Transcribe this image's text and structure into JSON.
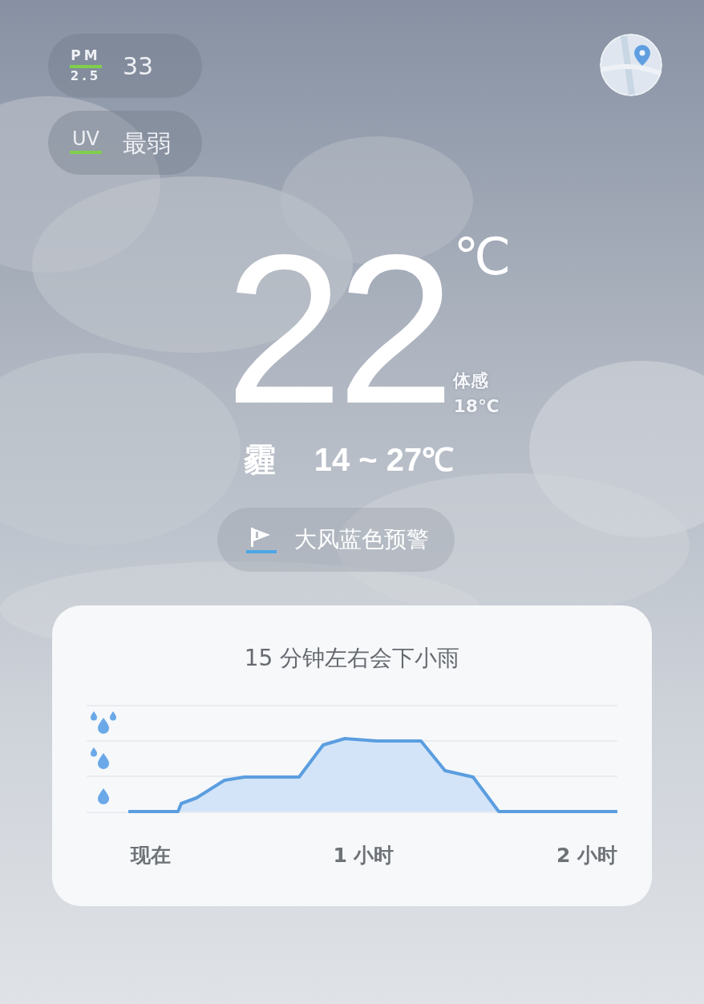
{
  "badges": [
    {
      "kind": "pm",
      "label": "PM",
      "sublabel": "2.5",
      "value": "33"
    },
    {
      "kind": "uv",
      "label": "UV",
      "value": "最弱"
    }
  ],
  "current": {
    "temperature": "22",
    "unit": "℃",
    "feels_label": "体感",
    "feels_value": "18℃"
  },
  "condition": "霾",
  "range": "14 ~ 27℃",
  "alert": {
    "text": "大风蓝色预警"
  },
  "forecast": {
    "title": "15 分钟左右会下小雨",
    "x_labels": [
      "现在",
      "1 小时",
      "2 小时"
    ]
  }
}
